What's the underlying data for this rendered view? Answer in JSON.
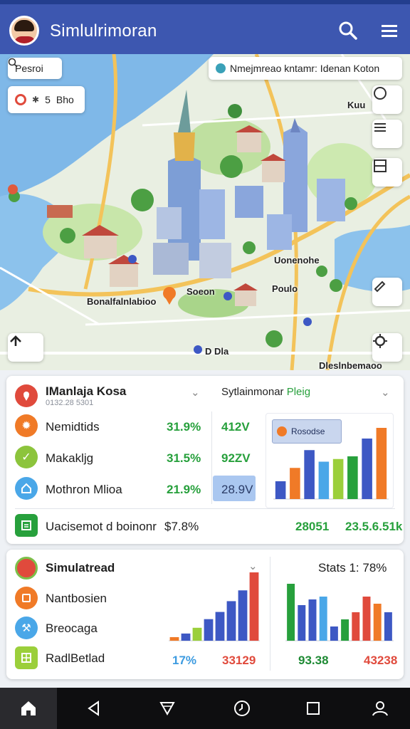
{
  "header": {
    "title": "Simlulrimoran"
  },
  "map": {
    "search_chip": "Pesroi",
    "banner": "Nmejmreao kntamr: Idenan Koton",
    "filter_chip": {
      "count": "5",
      "label": "Bho"
    },
    "corner_label": "Kuu",
    "labels": {
      "west": "Bonalfalnlabioo",
      "center": "Soeon",
      "east": "Uonenohe",
      "east2": "Poulo",
      "bottom_center": "D Dla",
      "bottom_right": "Dleslnbemaoo"
    }
  },
  "panel1": {
    "title": "IManlaja Kosa",
    "subtitle": "0132.28 5301",
    "right_title_a": "Sytlainmonar",
    "right_title_b": "Pleig",
    "rows": [
      {
        "label": "Nemidtids",
        "pct": "31.9%",
        "val": "412V"
      },
      {
        "label": "Makakljg",
        "pct": "31.5%",
        "val": "92ZV"
      },
      {
        "label": "Mothron Mlioa",
        "pct": "21.9%",
        "val": "28.9V"
      }
    ],
    "footer_label": "Uacisemot d boinonr",
    "footer_pct": "$7.8%",
    "footer_v1": "28051",
    "footer_v2": "23.5.6.51k",
    "chart_badge": "Rosodse"
  },
  "panel2": {
    "title": "Simulatread",
    "stats_label": "Stats 1: 78%",
    "rows": [
      {
        "label": "Nantbosien"
      },
      {
        "label": "Breocaga"
      },
      {
        "label": "RadlBetlad"
      }
    ],
    "v1": "17%",
    "v2": "33129",
    "v3": "93.38",
    "v4": "43238"
  },
  "chart_data": [
    {
      "type": "bar",
      "categories": [
        "1",
        "2",
        "3",
        "4",
        "5",
        "6",
        "7",
        "8"
      ],
      "series": [
        {
          "values": [
            20,
            35,
            55,
            42,
            45,
            48,
            68,
            80
          ]
        }
      ],
      "colors": [
        "#3d58c4",
        "#f07a27",
        "#3d58c4",
        "#4aa7e8",
        "#9bcf3b",
        "#27a03c",
        "#3d58c4",
        "#f07a27"
      ]
    },
    {
      "type": "bar",
      "categories": [
        "1",
        "2",
        "3",
        "4",
        "5",
        "6",
        "7",
        "8"
      ],
      "series": [
        {
          "values": [
            5,
            10,
            18,
            30,
            40,
            55,
            70,
            95
          ]
        }
      ],
      "colors": [
        "#f07a27",
        "#3d58c4",
        "#9bcf3b",
        "#3d58c4",
        "#3d58c4",
        "#3d58c4",
        "#3d58c4",
        "#e04a3c"
      ]
    },
    {
      "type": "bar",
      "categories": [
        "1",
        "2",
        "3",
        "4",
        "5",
        "6",
        "7",
        "8",
        "9",
        "10"
      ],
      "series": [
        {
          "values": [
            80,
            50,
            58,
            62,
            20,
            30,
            40,
            62,
            52,
            40
          ]
        }
      ],
      "colors": [
        "#27a03c",
        "#3d58c4",
        "#3d58c4",
        "#4aa7e8",
        "#3d58c4",
        "#27a03c",
        "#e04a3c",
        "#e04a3c",
        "#f07a27",
        "#3d58c4"
      ]
    }
  ]
}
